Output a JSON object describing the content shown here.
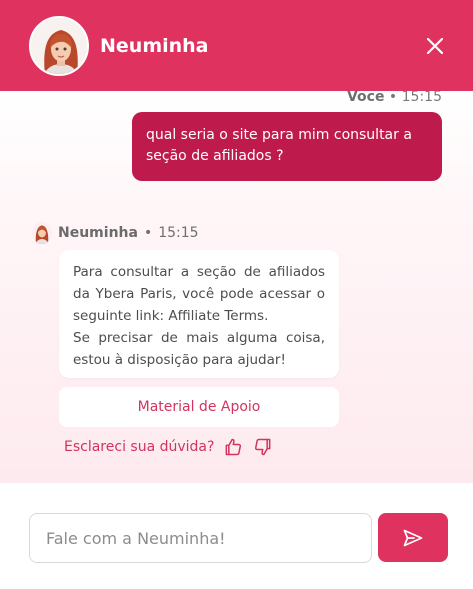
{
  "header": {
    "title": "Neuminha",
    "avatar_icon": "woman-avatar-icon",
    "close_icon": "close-icon"
  },
  "messages": [
    {
      "sender": "Voce",
      "time": "15:15",
      "text": "qual seria o site para mim consultar a seção de afiliados ?"
    },
    {
      "sender": "Neuminha",
      "time": "15:15",
      "lines": [
        "Para consultar a seção de afiliados da Ybera Paris, você pode acessar o seguinte link: Affiliate Terms.",
        "Se precisar de mais alguma coisa, estou à disposição para ajudar!"
      ]
    }
  ],
  "meta_separator": "•",
  "support_button": {
    "label": "Material de Apoio"
  },
  "feedback": {
    "question": "Esclareci sua dúvida?",
    "like_icon": "thumbs-up-icon",
    "dislike_icon": "thumbs-down-icon"
  },
  "input": {
    "placeholder": "Fale com a Neuminha!",
    "value": ""
  },
  "send_icon": "send-icon",
  "colors": {
    "brand": "#e0325e",
    "user_bubble": "#be1a4b",
    "accent_text": "#d3345f"
  }
}
